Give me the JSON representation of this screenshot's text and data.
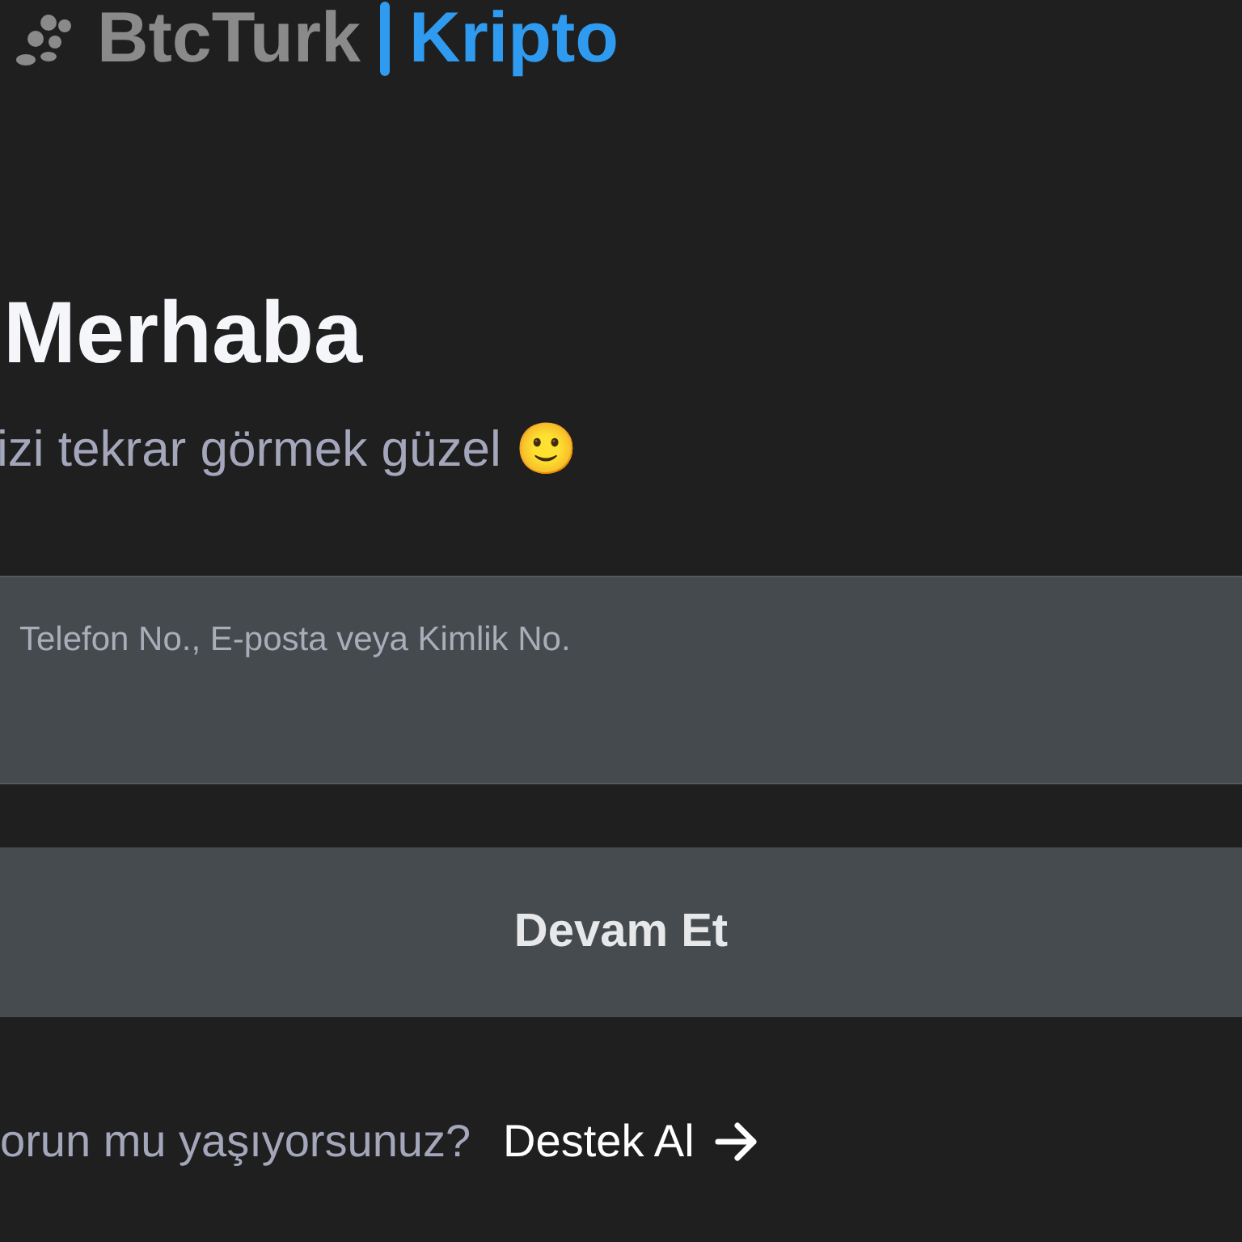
{
  "logo": {
    "brand": "BtcTurk",
    "product": "Kripto"
  },
  "title": "Merhaba",
  "subtitle": "izi tekrar görmek güzel 🙂",
  "login_field": {
    "placeholder": "Telefon No., E-posta veya Kimlik No."
  },
  "continue_button": "Devam Et",
  "help": {
    "question": "orun mu yaşıyorsunuz?",
    "link": "Destek Al"
  }
}
